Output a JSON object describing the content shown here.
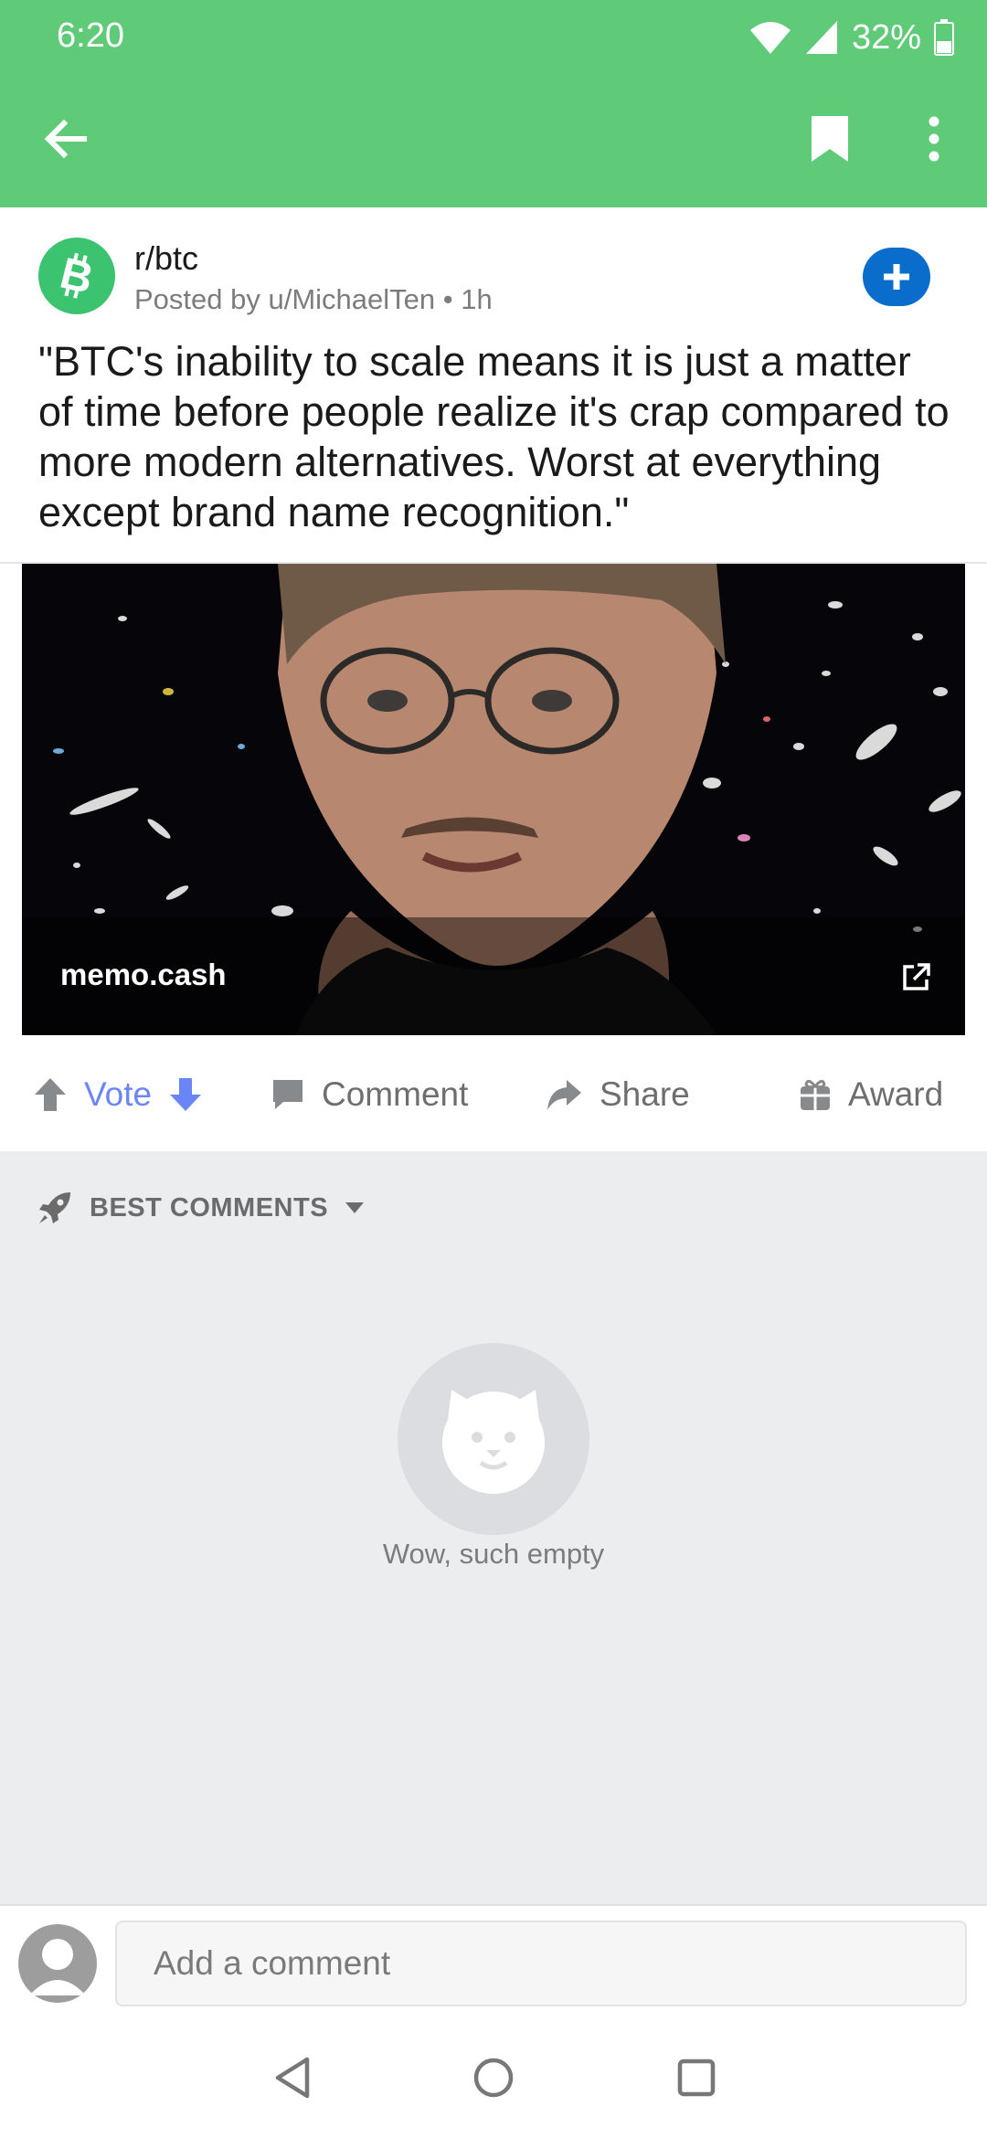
{
  "status_bar": {
    "time": "6:20",
    "battery": "32%"
  },
  "toolbar": {
    "back_icon": "arrow-left-icon",
    "bookmark_icon": "bookmark-icon",
    "more_icon": "more-vert-icon"
  },
  "post": {
    "subreddit": "r/btc",
    "posted_by": "Posted by u/MichaelTen • 1h",
    "title": "\"BTC's inability to scale means it is just a matter of time before people realize it's crap compared to more modern alternatives. Worst at everything except brand name recognition.\"",
    "link_domain": "memo.cash"
  },
  "actions": {
    "vote": "Vote",
    "comment": "Comment",
    "share": "Share",
    "award": "Award"
  },
  "comments": {
    "sort_label": "BEST COMMENTS",
    "empty_text": "Wow, such empty"
  },
  "composer": {
    "placeholder": "Add a comment"
  },
  "colors": {
    "brand_green": "#5FCA78",
    "join_blue": "#0A6CCB",
    "vote_blue": "#6A85F5"
  }
}
